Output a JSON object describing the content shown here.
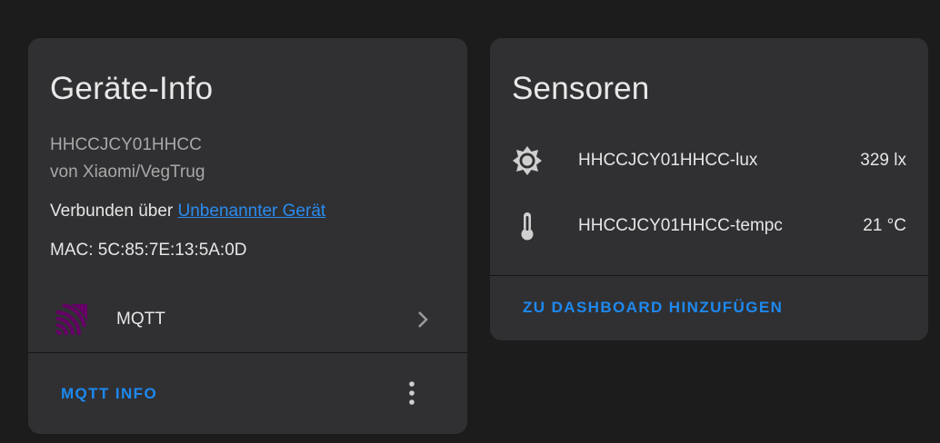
{
  "device_card": {
    "title": "Geräte-Info",
    "model": "HHCCJCY01HHCC",
    "manufacturer": "von Xiaomi/VegTrug",
    "connected_via_prefix": "Verbunden über ",
    "connected_via_link": "Unbenannter Gerät",
    "mac": "MAC: 5C:85:7E:13:5A:0D",
    "integration": {
      "label": "MQTT",
      "icon": "mqtt-icon",
      "icon_color": "#660066"
    },
    "action_label": "MQTT INFO",
    "more_icon": "more-vert-icon"
  },
  "sensor_card": {
    "title": "Sensoren",
    "sensors": [
      {
        "name": "HHCCJCY01HHCC-lux",
        "value": "329 lx",
        "icon": "brightness-icon"
      },
      {
        "name": "HHCCJCY01HHCC-tempc",
        "value": "21 °C",
        "icon": "thermometer-icon"
      }
    ],
    "action_label": "ZU DASHBOARD HINZUFÜGEN"
  },
  "colors": {
    "background": "#1c1c1c",
    "card": "#303033",
    "accent": "#1d89f0",
    "link": "#2a8cf0"
  }
}
